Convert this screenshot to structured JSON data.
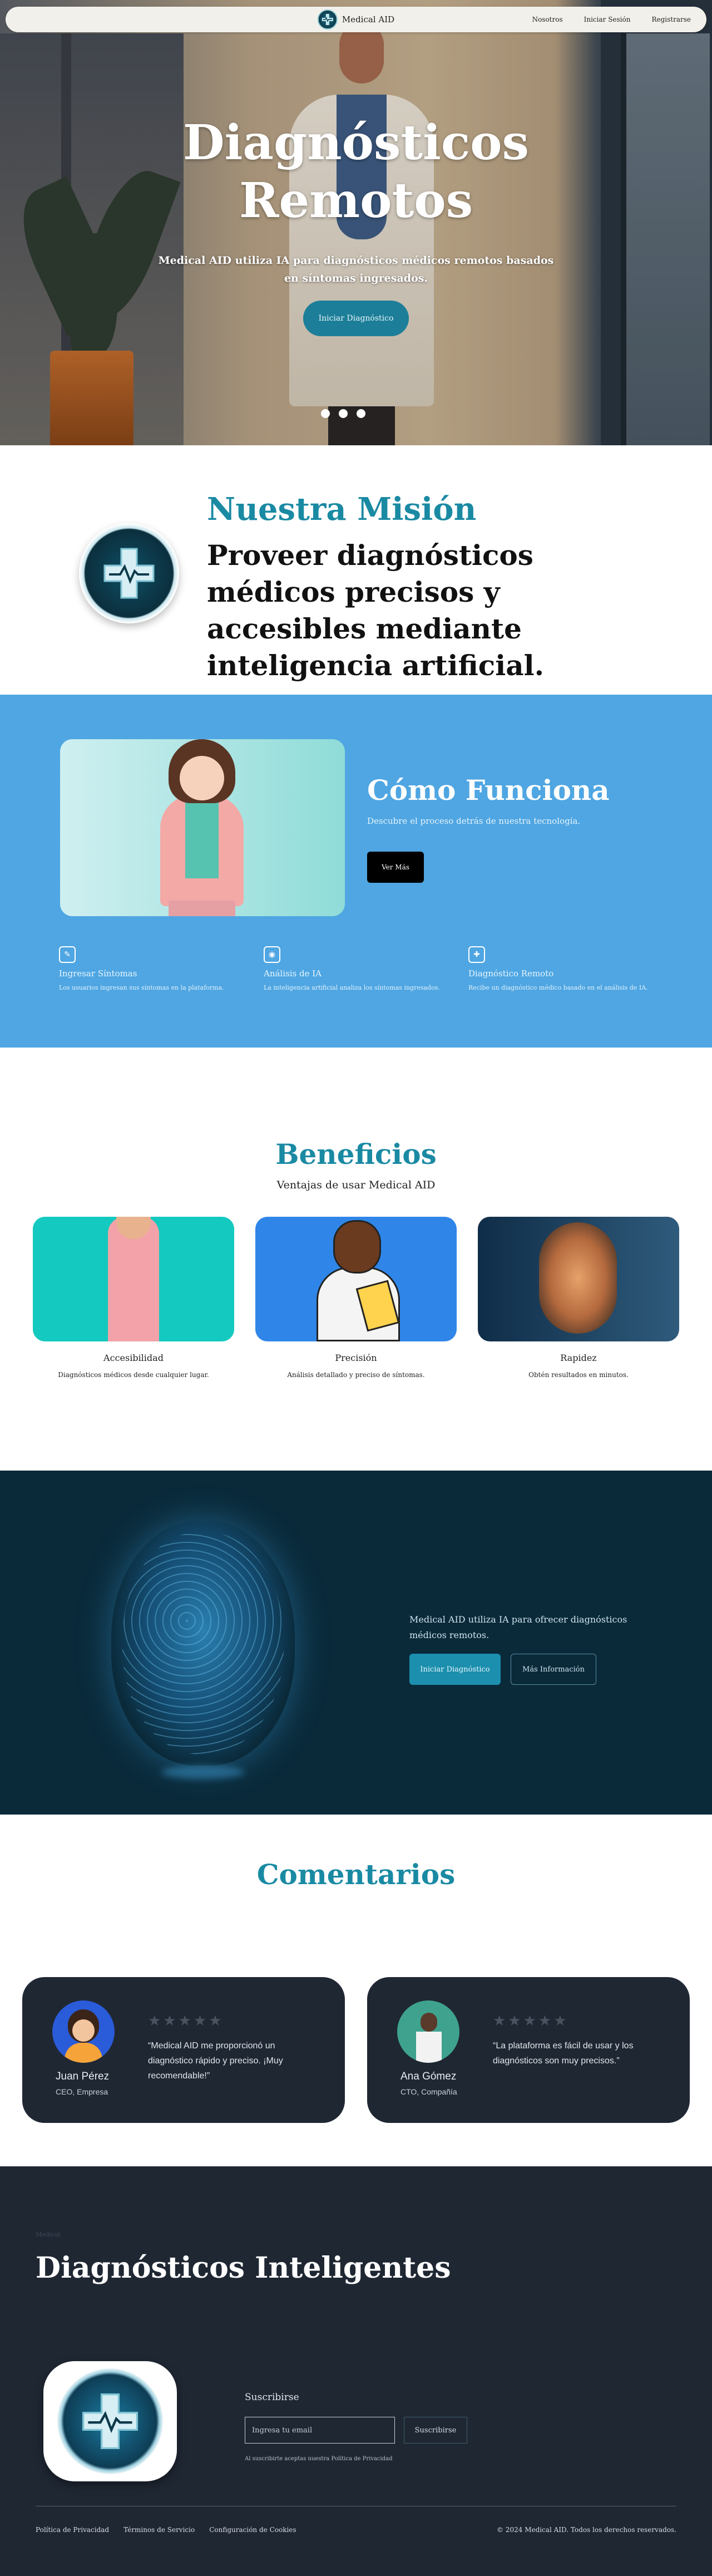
{
  "nav": {
    "brand": "Medical AID",
    "links": [
      "Nosotros",
      "Iniciar Sesión",
      "Registrarse"
    ]
  },
  "hero": {
    "title_line1": "Diagnósticos",
    "title_line2": "Remotos",
    "subtitle": "Medical AID utiliza IA para diagnósticos médicos remotos basados en síntomas ingresados.",
    "cta": "Iniciar Diagnóstico",
    "slide_count": 3
  },
  "mission": {
    "title": "Nuestra Misión",
    "text": "Proveer diagnósticos médicos precisos y accesibles mediante inteligencia artificial."
  },
  "how": {
    "title": "Cómo Funciona",
    "description": "Descubre el proceso detrás de nuestra tecnología.",
    "button": "Ver Más",
    "steps": [
      {
        "icon": "chat-icon",
        "title": "Ingresar Síntomas",
        "text": "Los usuarios ingresan sus síntomas en la plataforma."
      },
      {
        "icon": "ai-chip-icon",
        "title": "Análisis de IA",
        "text": "La inteligencia artificial analiza los síntomas ingresados."
      },
      {
        "icon": "diagnosis-icon",
        "title": "Diagnóstico Remoto",
        "text": "Recibe un diagnóstico médico basado en el análisis de IA."
      }
    ]
  },
  "benefits": {
    "title": "Beneficios",
    "subtitle": "Ventajas de usar Medical AID",
    "cards": [
      {
        "title": "Accesibilidad",
        "text": "Diagnósticos médicos desde cualquier lugar."
      },
      {
        "title": "Precisión",
        "text": "Análisis detallado y preciso de síntomas."
      },
      {
        "title": "Rapidez",
        "text": "Obtén resultados en minutos."
      }
    ]
  },
  "brain": {
    "text": "Medical AID utiliza IA para ofrecer diagnósticos médicos remotos.",
    "primary": "Iniciar Diagnóstico",
    "secondary": "Más Información"
  },
  "comments": {
    "title": "Comentarios",
    "items": [
      {
        "name": "Juan Pérez",
        "role": "CEO, Empresa",
        "quote": "“Medical AID me proporcionó un diagnóstico rápido y preciso. ¡Muy recomendable!”",
        "stars": "★★★★★"
      },
      {
        "name": "Ana Gómez",
        "role": "CTO, Compañía",
        "quote": "“La plataforma es fácil de usar y los diagnósticos son muy precisos.”",
        "stars": "★★★★★"
      }
    ]
  },
  "footer": {
    "tiny": "Medical",
    "title": "Diagnósticos Inteligentes",
    "subscribe_title": "Suscribirse",
    "email_placeholder": "Ingresa tu email",
    "subscribe_button": "Suscribirse",
    "legal": "Al suscribirte aceptas nuestra Política de Privacidad",
    "links": [
      "Política de Privacidad",
      "Términos de Servicio",
      "Configuración de Cookies"
    ],
    "copyright": "© 2024 Medical AID. Todos los derechos reservados."
  }
}
